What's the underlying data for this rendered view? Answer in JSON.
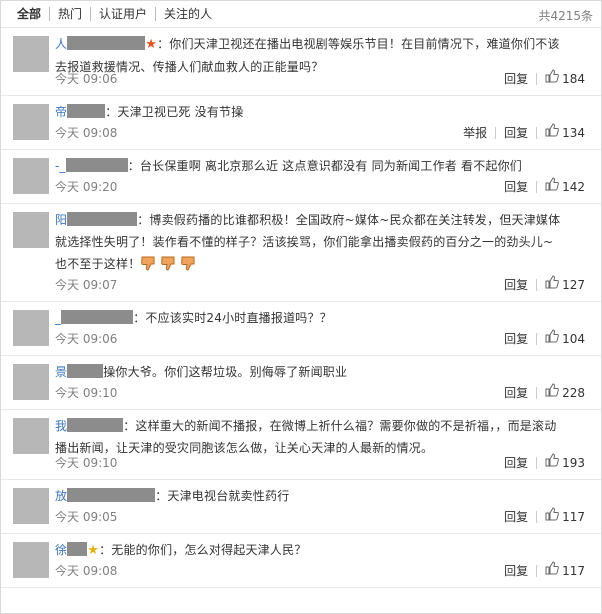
{
  "tabs": [
    "全部",
    "热门",
    "认证用户",
    "关注的人"
  ],
  "total": "共4215条",
  "actions": {
    "reply": "回复",
    "report": "举报"
  },
  "colors": {
    "name": "#3a75c4",
    "meta": "#808080",
    "avatar_placeholder": "#b7b7b7"
  },
  "comments": [
    {
      "name": "人",
      "badge": "★",
      "text": "：你们天津卫视还在播出电视剧等娱乐节目！在目前情况下，难道你们不该去报道救援情况、传播人们献血救人的正能量吗？",
      "time": "今天 09:06",
      "likes": "184",
      "report": false
    },
    {
      "name": "帝",
      "badge": "",
      "text": "：天津卫视已死 没有节操",
      "time": "今天 09:08",
      "likes": "134",
      "report": true
    },
    {
      "name": "-_",
      "badge": "",
      "text": "：台长保重啊 离北京那么近 这点意识都没有 同为新闻工作者 看不起你们",
      "time": "今天 09:20",
      "likes": "142",
      "report": false
    },
    {
      "name": "阳",
      "badge": "",
      "text": "：博卖假药播的比谁都积极！全国政府~媒体~民众都在关注转发，但天津媒体就选择性失明了！装作看不懂的样子？活该挨骂，你们能拿出播卖假药的百分之一的劲头儿~也不至于这样！",
      "emoji": "thumbs-down-emoji",
      "time": "今天 09:07",
      "likes": "127",
      "report": false
    },
    {
      "name": "_",
      "badge": "",
      "text": "：不应该实时24小时直播报道吗？？",
      "time": "今天 09:06",
      "likes": "104",
      "report": false
    },
    {
      "name": "景",
      "badge": "",
      "text": "操你大爷。你们这帮垃圾。别侮辱了新闻职业",
      "time": "今天 09:10",
      "likes": "228",
      "report": false
    },
    {
      "name": "我",
      "badge": "",
      "text": "：这样重大的新闻不播报，在微博上祈什么福？需要你做的不是祈福，，而是滚动播出新闻，让天津的受灾同胞该怎么做，让关心天津的人最新的情况。",
      "time": "今天 09:10",
      "likes": "193",
      "report": false
    },
    {
      "name": "放",
      "badge": "",
      "text": "：天津电视台就卖性药行",
      "time": "今天 09:05",
      "likes": "117",
      "report": false
    },
    {
      "name": "徐",
      "badge": "★",
      "text": "：无能的你们，怎么对得起天津人民？",
      "time": "今天 09:08",
      "likes": "117",
      "report": false
    }
  ]
}
